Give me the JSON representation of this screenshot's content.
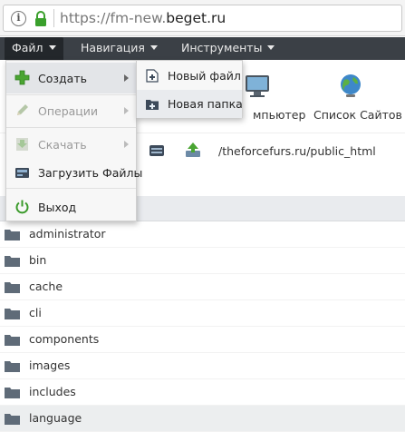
{
  "browser": {
    "url_prefix": "https://fm-new.",
    "url_domain": "beget.ru"
  },
  "menubar": {
    "file": "Файл",
    "navigation": "Навигация",
    "tools": "Инструменты"
  },
  "toolbar": {
    "computer_label": "мпьютер",
    "sites_label": "Список Сайтов"
  },
  "path": "/theforcefurs.ru/public_html",
  "file_menu": {
    "create": "Создать",
    "operations": "Операции",
    "download": "Скачать",
    "upload": "Загрузить Файлы",
    "exit": "Выход"
  },
  "create_submenu": {
    "new_file": "Новый файл",
    "new_folder": "Новая папка"
  },
  "files": [
    "administrator",
    "bin",
    "cache",
    "cli",
    "components",
    "images",
    "includes",
    "language"
  ],
  "selected_file": "language",
  "colors": {
    "menubar_bg": "#3b4046",
    "exit_icon_green": "#3a9a2a",
    "create_icon_green": "#4aa532"
  }
}
